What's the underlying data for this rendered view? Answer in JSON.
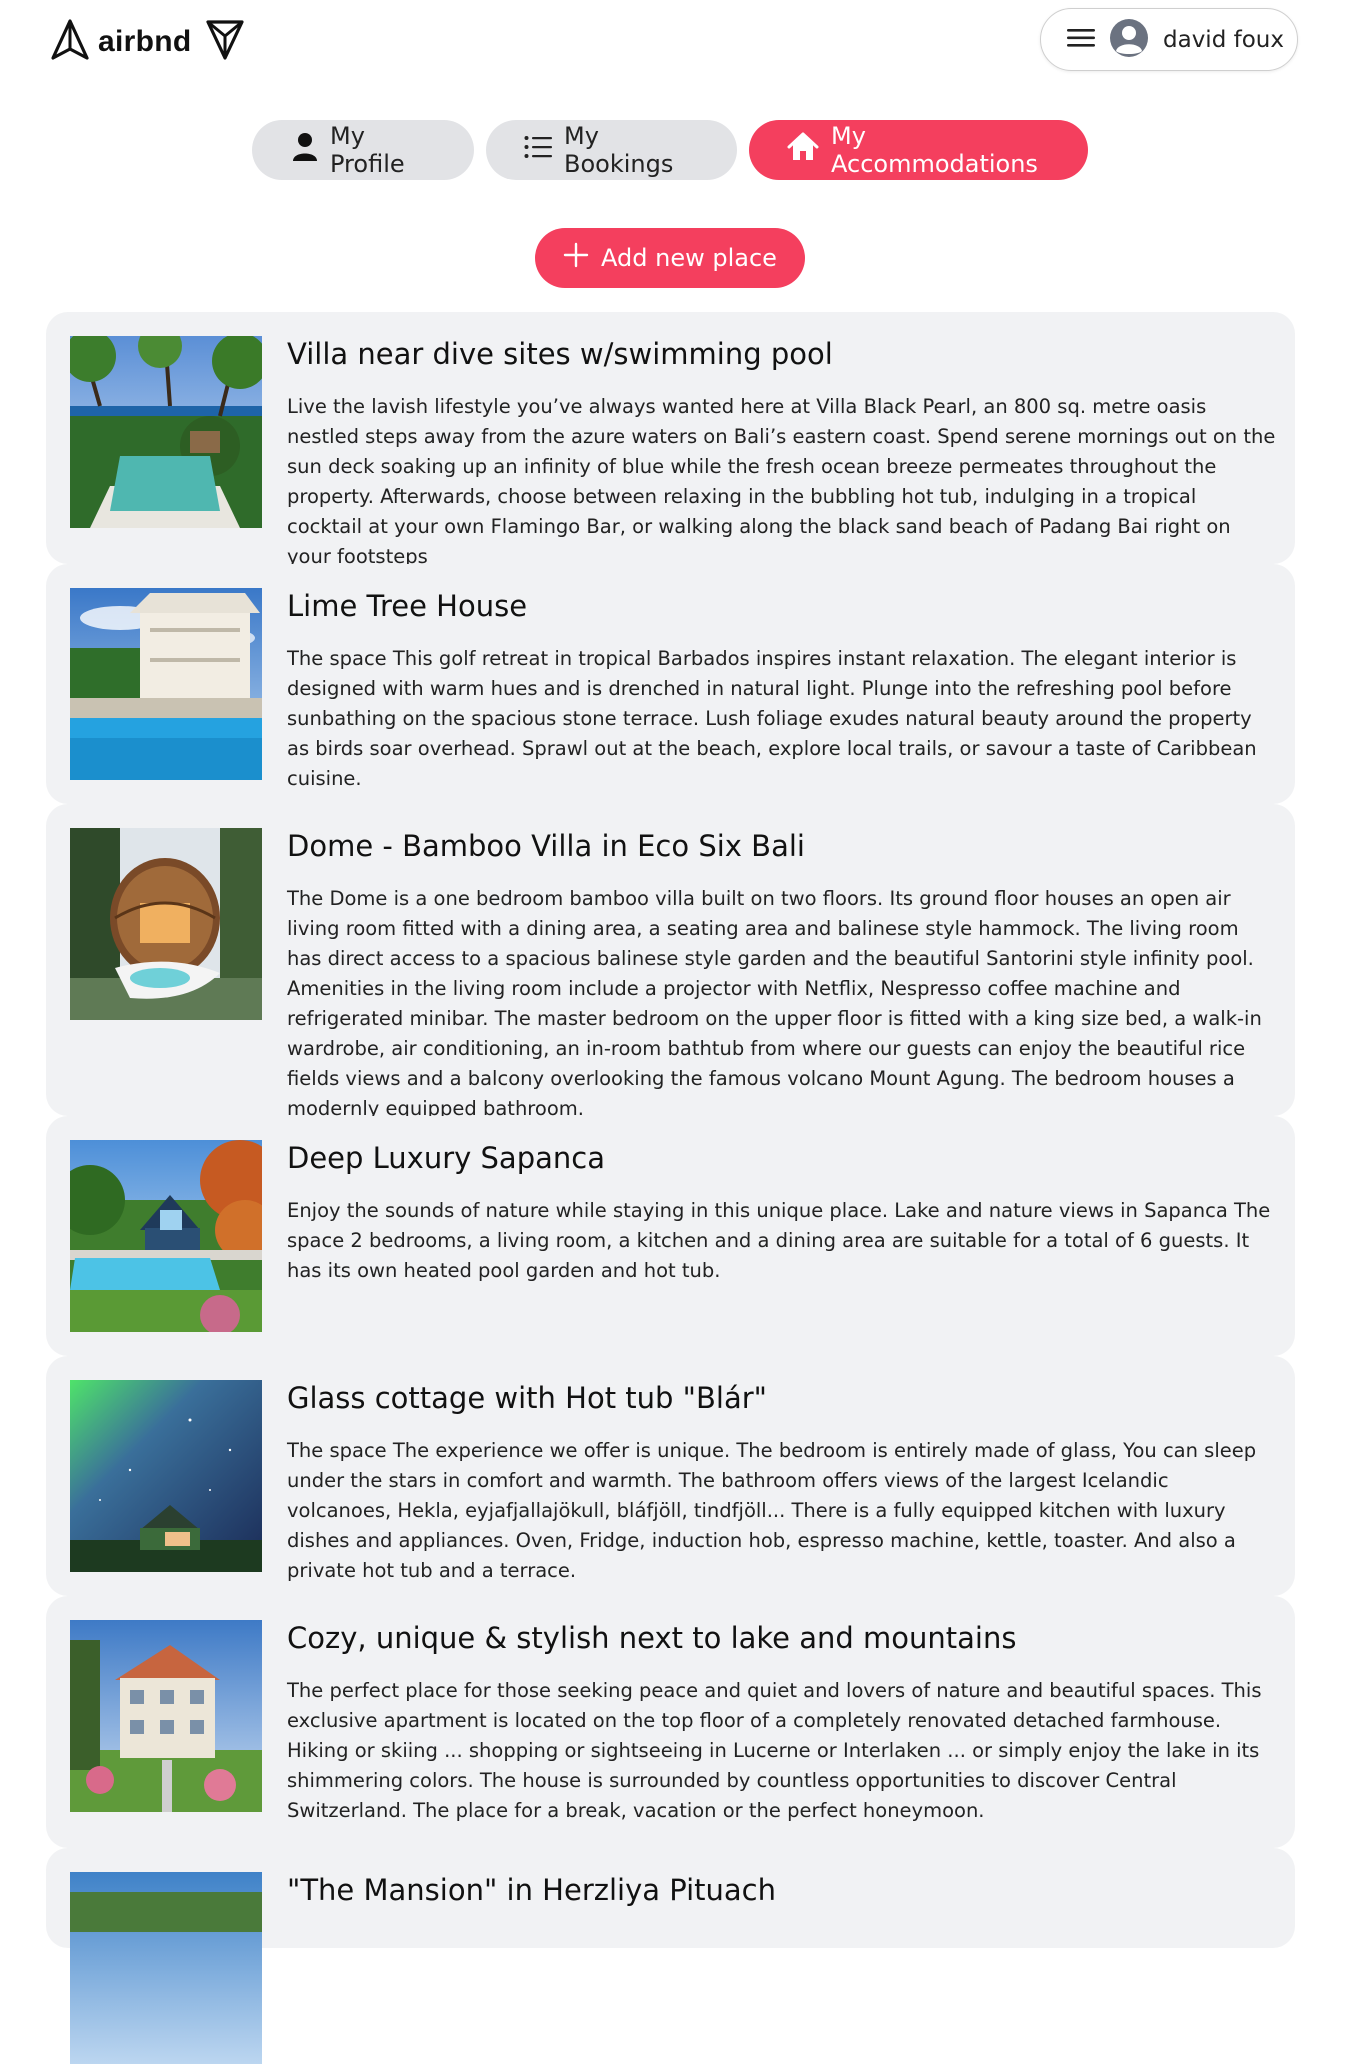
{
  "header": {
    "logo_text": "airbnd",
    "user_name": "david foux"
  },
  "nav": {
    "tabs": [
      {
        "label": "My Profile"
      },
      {
        "label": "My Bookings"
      },
      {
        "label": "My Accommodations",
        "active": true
      }
    ]
  },
  "actions": {
    "add_label": "Add new place"
  },
  "colors": {
    "primary": "#f43f5e",
    "tab_inactive": "#e2e3e6",
    "card_bg": "#f1f2f4"
  },
  "places": [
    {
      "title": "Villa near dive sites w/swimming pool",
      "description": "Live the lavish lifestyle you’ve always wanted here at Villa Black Pearl, an 800 sq. metre oasis nestled steps away from the azure waters on Bali’s eastern coast. Spend serene mornings out on the sun deck soaking up an infinity of blue while the fresh ocean breeze permeates throughout the property. Afterwards, choose between relaxing in the bubbling hot tub, indulging in a tropical cocktail at your own Flamingo Bar, or walking along the black sand beach of Padang Bai right on your footsteps"
    },
    {
      "title": "Lime Tree House",
      "description": "The space This golf retreat in tropical Barbados inspires instant relaxation. The elegant interior is designed with warm hues and is drenched in natural light. Plunge into the refreshing pool before sunbathing on the spacious stone terrace. Lush foliage exudes natural beauty around the property as birds soar overhead. Sprawl out at the beach, explore local trails, or savour a taste of Caribbean cuisine."
    },
    {
      "title": "Dome - Bamboo Villa in Eco Six Bali",
      "description": "The Dome is a one bedroom bamboo villa built on two floors. Its ground floor houses an open air living room fitted with a dining area, a seating area and balinese style hammock. The living room has direct access to a spacious balinese style garden and the beautiful Santorini style infinity pool. Amenities in the living room include a projector with Netflix, Nespresso coffee machine and refrigerated minibar. The master bedroom on the upper floor is fitted with a king size bed, a walk-in wardrobe, air conditioning, an in-room bathtub from where our guests can enjoy the beautiful rice fields views and a balcony overlooking the famous volcano Mount Agung. The bedroom houses a modernly equipped bathroom."
    },
    {
      "title": "Deep Luxury Sapanca",
      "description": "Enjoy the sounds of nature while staying in this unique place. Lake and nature views in Sapanca The space 2 bedrooms, a living room, a kitchen and a dining area are suitable for a total of 6 guests. It has its own heated pool garden and hot tub."
    },
    {
      "title": "Glass cottage with Hot tub \"Blár\"",
      "description": "The space The experience we offer is unique. The bedroom is entirely made of glass, You can sleep under the stars in comfort and warmth. The bathroom offers views of the largest Icelandic volcanoes, Hekla, eyjafjallajökull, bláfjöll, tindfjöll... There is a fully equipped kitchen with luxury dishes and appliances. Oven, Fridge, induction hob, espresso machine, kettle, toaster. And also a private hot tub and a terrace."
    },
    {
      "title": "Cozy, unique & stylish next to lake and mountains",
      "description": "The perfect place for those seeking peace and quiet and lovers of nature and beautiful spaces. This exclusive apartment is located on the top floor of a completely renovated detached farmhouse. Hiking or skiing ... shopping or sightseeing in Lucerne or Interlaken ... or simply enjoy the lake in its shimmering colors. The house is surrounded by countless opportunities to discover Central Switzerland. The place for a break, vacation or the perfect honeymoon."
    },
    {
      "title": "\"The Mansion\" in Herzliya Pituach",
      "description": ""
    }
  ]
}
